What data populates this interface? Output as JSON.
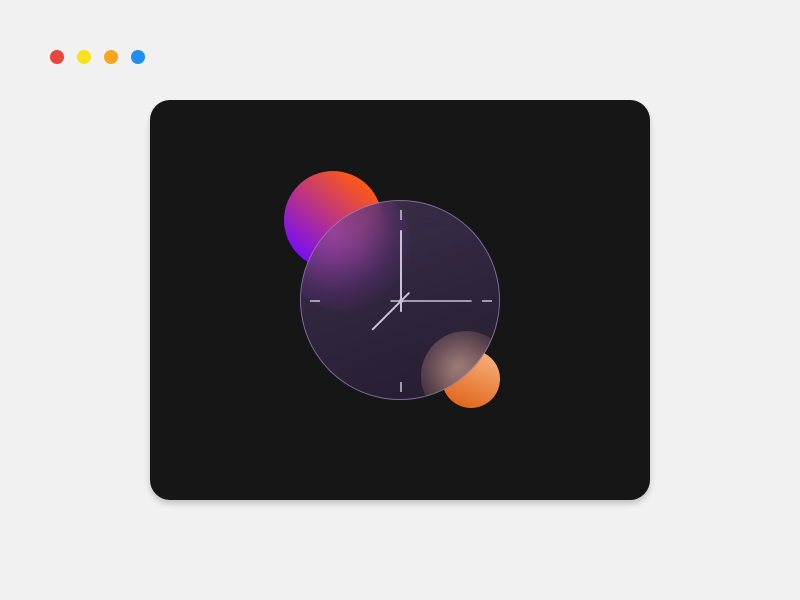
{
  "window_controls": [
    {
      "name": "close",
      "color": "#e8453c"
    },
    {
      "name": "minimize",
      "color": "#f9e21b"
    },
    {
      "name": "fullscreen",
      "color": "#f7a51c"
    },
    {
      "name": "extra",
      "color": "#1e8ef0"
    }
  ],
  "card": {
    "background": "#161616"
  },
  "clock": {
    "time": {
      "hours": 7.5,
      "minutes": 0,
      "seconds": 15
    },
    "hand_color": "#c9c3d6",
    "tick_color": "#c9c3d6",
    "orbs": {
      "top": {
        "gradient_from": "#ff5a14",
        "gradient_to": "#7a10f0"
      },
      "bottom": {
        "gradient_from": "#f7b07a",
        "gradient_to": "#e0661c"
      }
    }
  }
}
